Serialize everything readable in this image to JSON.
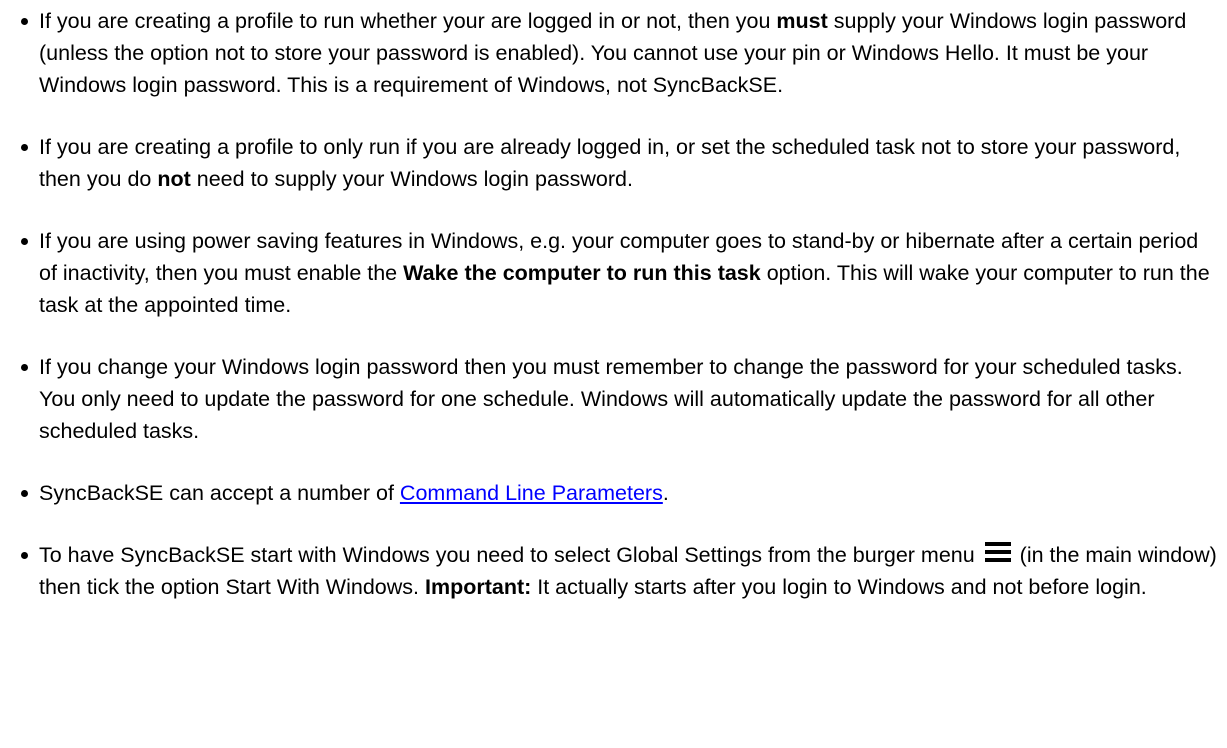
{
  "items": [
    {
      "t1": "If you are creating a profile to run whether your are logged in or not, then you ",
      "b1": "must",
      "t2": " supply your Windows login password (unless the option not to store your password is enabled). You cannot use your pin or Windows Hello. It must be your Windows login password. This is a requirement of Windows, not SyncBackSE."
    },
    {
      "t1": "If you are creating a profile to only run if you are already logged in, or set the scheduled task not to store your password, then you do ",
      "b1": "not",
      "t2": " need to supply your Windows login password."
    },
    {
      "t1": "If you are using power saving features in Windows, e.g. your computer goes to stand-by or hibernate after a certain period of inactivity, then you must enable the ",
      "b1": "Wake the computer to run this task",
      "t2": " option. This will wake your computer to run the task at the appointed time."
    },
    {
      "t1": "If you change your Windows login password then you must remember to change the password for your scheduled tasks. You only need to update the password for one schedule. Windows will automatically update the password for all other scheduled tasks."
    },
    {
      "t1": "SyncBackSE can accept a number of ",
      "link": "Command Line Parameters",
      "t2": "."
    },
    {
      "t1": "To have SyncBackSE start with Windows you need to select Global Settings from the burger menu ",
      "icon": "burger-menu-icon",
      "t2": " (in the main window) then tick the option Start With Windows. ",
      "b1": "Important:",
      "t3": " It actually starts after you login to Windows and not before login."
    }
  ]
}
